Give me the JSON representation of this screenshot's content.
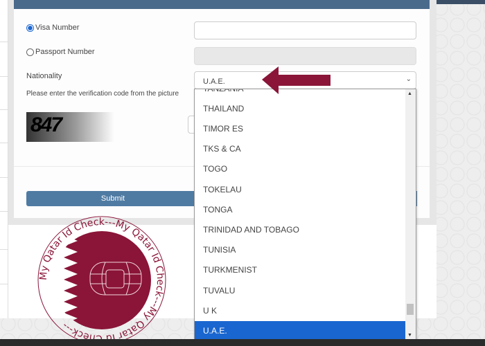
{
  "form": {
    "visa_label": "Visa Number",
    "passport_label": "Passport Number",
    "nationality_label": "Nationality",
    "nationality_value": "U.A.E.",
    "captcha_prompt": "Please enter the verification code from the picture",
    "captcha_code": "847",
    "submit_label": "Submit",
    "selected_id_type": "visa"
  },
  "dropdown": {
    "partial_top": "TANZANIA",
    "options": [
      "THAILAND",
      "TIMOR ES",
      "TKS & CA",
      "TOGO",
      "TOKELAU",
      "TONGA",
      "TRINIDAD AND TOBAGO",
      "TUNISIA",
      "TURKMENIST",
      "TUVALU",
      "U K",
      "U.A.E."
    ],
    "selected": "U.A.E.",
    "selected_color": "#1a66d0"
  },
  "watermark": {
    "text": "My Qatar Id Check---My Qatar Id Check---",
    "color": "#8a1538"
  },
  "colors": {
    "header": "#4a6a8c",
    "submit": "#4f7ba3",
    "arrow": "#8a1538"
  }
}
